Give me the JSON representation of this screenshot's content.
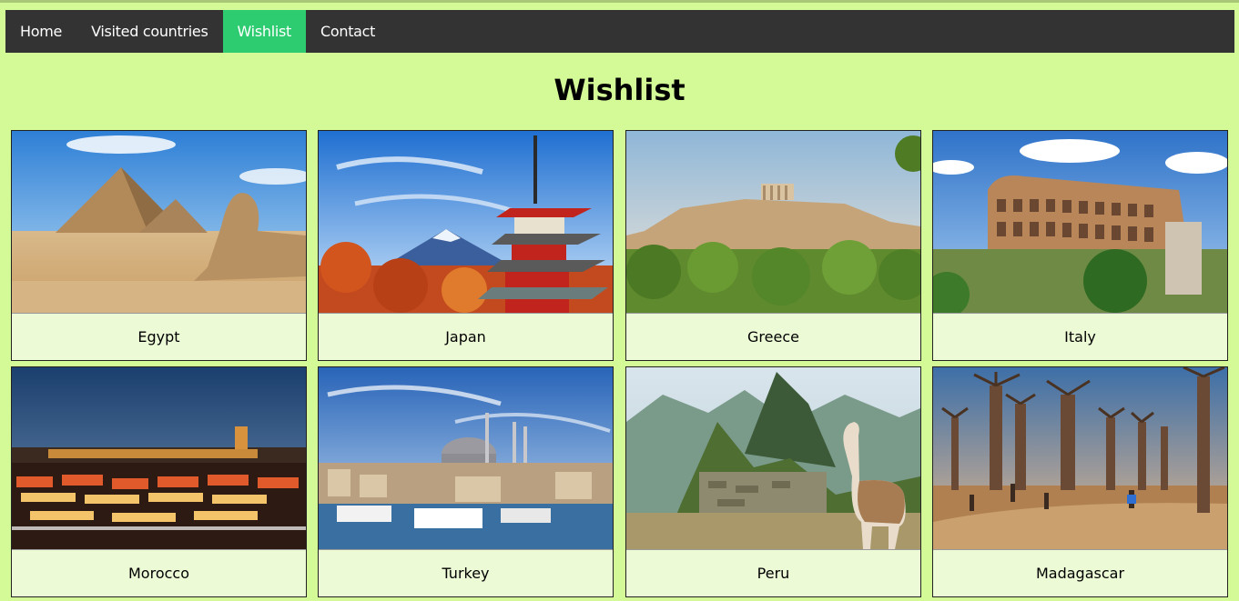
{
  "nav": {
    "items": [
      {
        "label": "Home",
        "active": false
      },
      {
        "label": "Visited countries",
        "active": false
      },
      {
        "label": "Wishlist",
        "active": true
      },
      {
        "label": "Contact",
        "active": false
      }
    ]
  },
  "page": {
    "title": "Wishlist"
  },
  "wishlist": {
    "cards": [
      {
        "name": "Egypt",
        "image_icon": "pyramids-sphinx-photo"
      },
      {
        "name": "Japan",
        "image_icon": "mount-fuji-pagoda-photo"
      },
      {
        "name": "Greece",
        "image_icon": "acropolis-photo"
      },
      {
        "name": "Italy",
        "image_icon": "colosseum-photo"
      },
      {
        "name": "Morocco",
        "image_icon": "marrakech-market-photo"
      },
      {
        "name": "Turkey",
        "image_icon": "istanbul-mosque-photo"
      },
      {
        "name": "Peru",
        "image_icon": "machu-picchu-llama-photo"
      },
      {
        "name": "Madagascar",
        "image_icon": "baobab-avenue-photo"
      }
    ]
  },
  "colors": {
    "background": "#d4fa97",
    "nav_bg": "#333333",
    "nav_active": "#2ecc71",
    "card_bg": "#ecfad6"
  }
}
